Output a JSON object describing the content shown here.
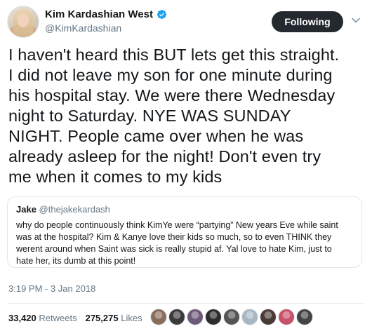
{
  "author": {
    "display_name": "Kim Kardashian West",
    "handle": "@KimKardashian",
    "verified": true,
    "avatar_icon": "profile-photo"
  },
  "follow_button": {
    "label": "Following"
  },
  "menu_icon": "chevron-down-icon",
  "tweet": {
    "text": "I haven't heard this BUT lets get this straight.\nI did not leave my son for one minute during\nhis hospital stay. We were there Wednesday\nnight to Saturday. NYE WAS SUNDAY\nNIGHT. People came over when he was\nalready asleep for the night! Don't even try\nme when it comes to my kids",
    "timestamp": "3:19 PM - 3 Jan 2018"
  },
  "quoted_tweet": {
    "name": "Jake",
    "handle": "@thejakekardash",
    "text": "why do people continuously think KimYe were “partying” New years Eve while saint\nwas at the hospital? Kim & Kanye love their kids so much, so to even THINK they\nwerent around when Saint was sick is really stupid af. Yal love to hate Kim, just to\nhate her, its dumb at this point!"
  },
  "stats": {
    "retweets_count": "33,420",
    "retweets_label": "Retweets",
    "likes_count": "275,275",
    "likes_label": "Likes"
  },
  "liker_avatars": [
    {
      "color": "#8a6d5b"
    },
    {
      "color": "#3b3b3b"
    },
    {
      "color": "#6e5a78"
    },
    {
      "color": "#2d2d2d"
    },
    {
      "color": "#555555"
    },
    {
      "color": "#a8b7c4"
    },
    {
      "color": "#4a3a35"
    },
    {
      "color": "#c7536a"
    },
    {
      "color": "#444444"
    }
  ],
  "colors": {
    "accent": "#1da1f2",
    "follow_bg": "#24292f",
    "secondary_text": "#657786"
  }
}
